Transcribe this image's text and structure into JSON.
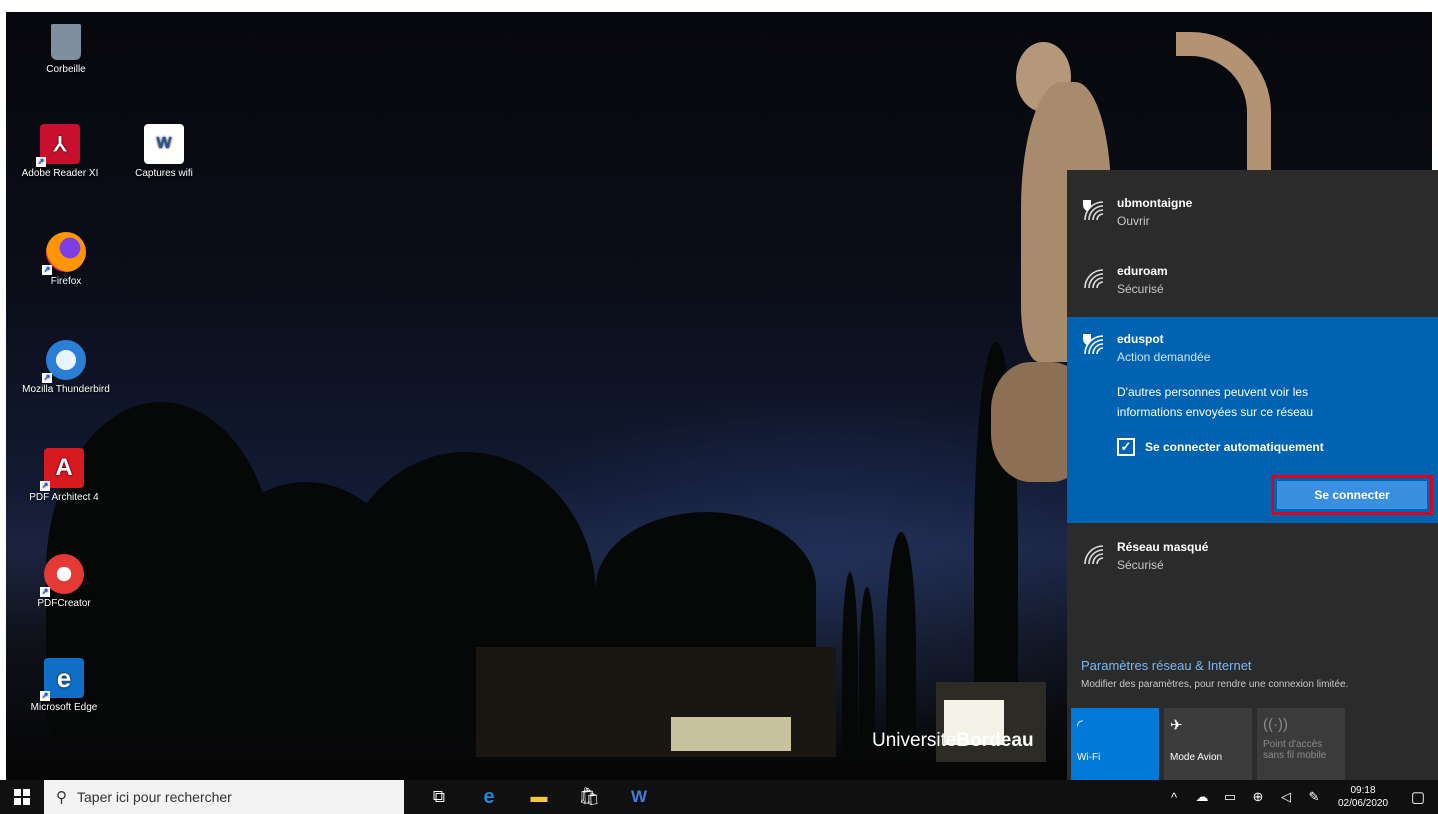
{
  "desktop_icons": [
    {
      "label": "Corbeille",
      "icon": "recycle-bin-icon"
    },
    {
      "label": "Adobe Reader XI",
      "icon": "adobe-reader-icon"
    },
    {
      "label": "Captures wifi",
      "icon": "word-document-icon"
    },
    {
      "label": "Firefox",
      "icon": "firefox-icon"
    },
    {
      "label": "Mozilla Thunderbird",
      "icon": "thunderbird-icon"
    },
    {
      "label": "PDF Architect 4",
      "icon": "pdf-architect-icon"
    },
    {
      "label": "PDFCreator",
      "icon": "pdfcreator-icon"
    },
    {
      "label": "Microsoft Edge",
      "icon": "edge-icon"
    }
  ],
  "wallpaper": {
    "brand_text_1": "Universite",
    "brand_text_2": "Bordeau"
  },
  "network_panel": {
    "networks": [
      {
        "name": "ubmontaigne",
        "status": "Ouvrir"
      },
      {
        "name": "eduroam",
        "status": "Sécurisé"
      },
      {
        "name": "eduspot",
        "status": "Action demandée"
      },
      {
        "name": "Réseau masqué",
        "status": "Sécurisé"
      }
    ],
    "selected": {
      "warning": "D'autres personnes peuvent voir les informations envoyées sur ce réseau",
      "auto_connect_label": "Se connecter automatiquement",
      "auto_connect_checked": true,
      "connect_button": "Se connecter"
    },
    "settings_title": "Paramètres réseau & Internet",
    "settings_subtitle": "Modifier des paramètres, pour rendre une connexion limitée.",
    "quick_actions": [
      {
        "label": "Wi-Fi",
        "active": true
      },
      {
        "label": "Mode Avion",
        "active": false
      },
      {
        "label": "Point d'accès sans fil mobile",
        "active": false
      }
    ]
  },
  "taskbar": {
    "search_placeholder": "Taper ici pour rechercher",
    "time": "09:18",
    "date": "02/06/2020"
  },
  "colors": {
    "panel_bg": "#2b2b2b",
    "selected_bg": "#0063b1",
    "accent": "#0078d7",
    "highlight_border": "#e0001a"
  }
}
